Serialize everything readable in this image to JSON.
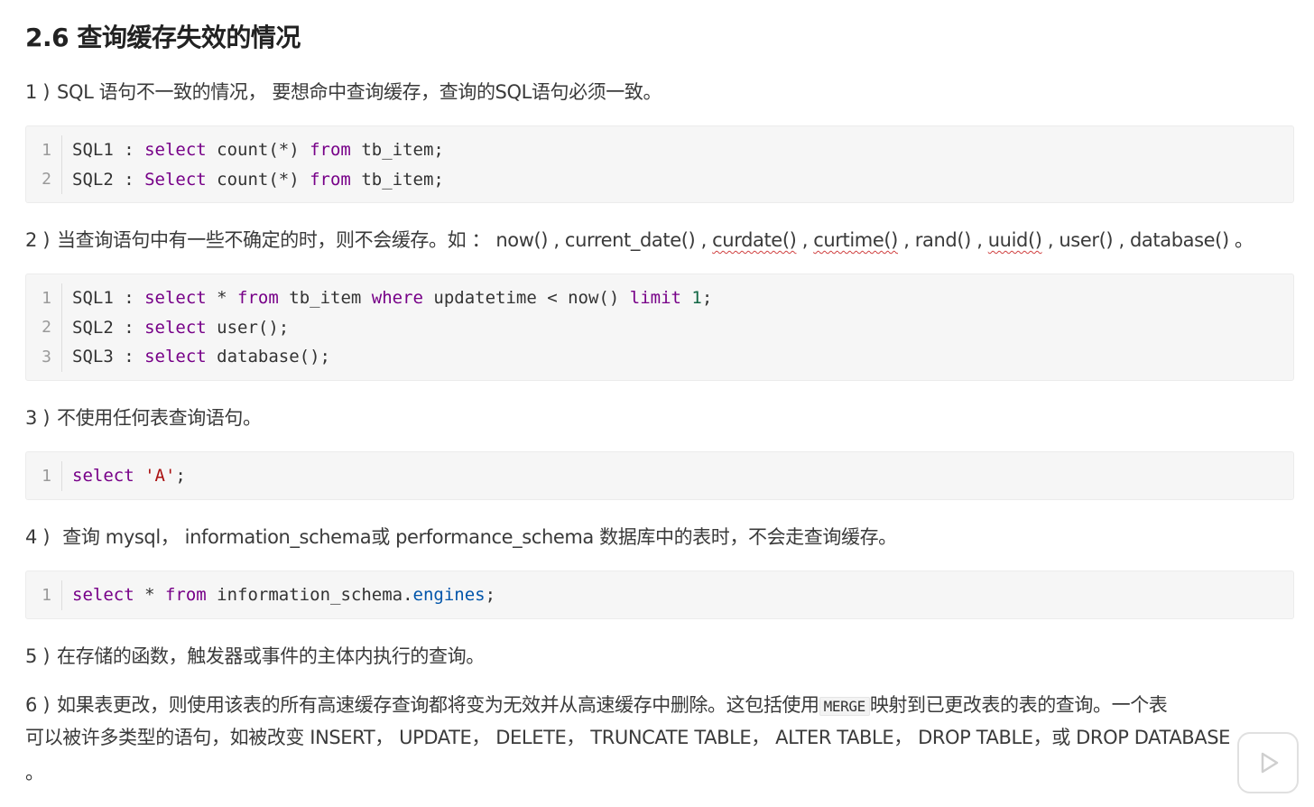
{
  "heading": "2.6 查询缓存失效的情况",
  "sections": [
    {
      "num": "1 )",
      "text": "SQL 语句不一致的情况， 要想命中查询缓存，查询的SQL语句必须一致。",
      "code": [
        {
          "ln": "1",
          "parts": [
            "SQL1 : ",
            "select",
            " count(*) ",
            "from",
            " tb_item;"
          ]
        },
        {
          "ln": "2",
          "parts": [
            "SQL2 : ",
            "Select",
            " count(*) ",
            "from",
            " tb_item;"
          ]
        }
      ]
    },
    {
      "num": "2 )",
      "text_a": "当查询语句中有一些不确定的时，则不会缓存。如 ： now() , current_date() , ",
      "text_curdate": "curdate()",
      "text_b": " , ",
      "text_curtime": "curtime()",
      "text_c": " , rand() , ",
      "text_uuid": "uuid()",
      "text_d": " , user() , database() 。",
      "code": [
        {
          "ln": "1",
          "parts": [
            "SQL1 : ",
            "select",
            " * ",
            "from",
            " tb_item ",
            "where",
            " updatetime < now() ",
            "limit",
            " ",
            "1",
            ";"
          ]
        },
        {
          "ln": "2",
          "parts": [
            "SQL2 : ",
            "select",
            " user();"
          ]
        },
        {
          "ln": "3",
          "parts": [
            "SQL3 : ",
            "select",
            " database();"
          ]
        }
      ]
    },
    {
      "num": "3 )",
      "text": "不使用任何表查询语句。",
      "code": [
        {
          "ln": "1",
          "parts": [
            "select",
            " ",
            "'A'",
            ";"
          ]
        }
      ]
    },
    {
      "num": "4 )",
      "text": " 查询 mysql， information_schema或 performance_schema 数据库中的表时，不会走查询缓存。",
      "code": [
        {
          "ln": "1",
          "parts": [
            "select",
            " * ",
            "from",
            " information_schema.",
            "engines",
            ";"
          ]
        }
      ]
    },
    {
      "num": "5 )",
      "text": "在存储的函数，触发器或事件的主体内执行的查询。"
    },
    {
      "num": "6 )",
      "text_a": "如果表更改，则使用该表的所有高速缓存查询都将变为无效并从高速缓存中删除。这包括使用",
      "inline_code": "MERGE",
      "text_b": "映射到已更改表的表的查询。一个表",
      "line2": "可以被许多类型的语句，如被改变 INSERT， UPDATE， DELETE， TRUNCATE TABLE， ALTER TABLE， DROP TABLE，或 DROP DATABASE",
      "line3": "。"
    }
  ],
  "play_button": "play-icon"
}
